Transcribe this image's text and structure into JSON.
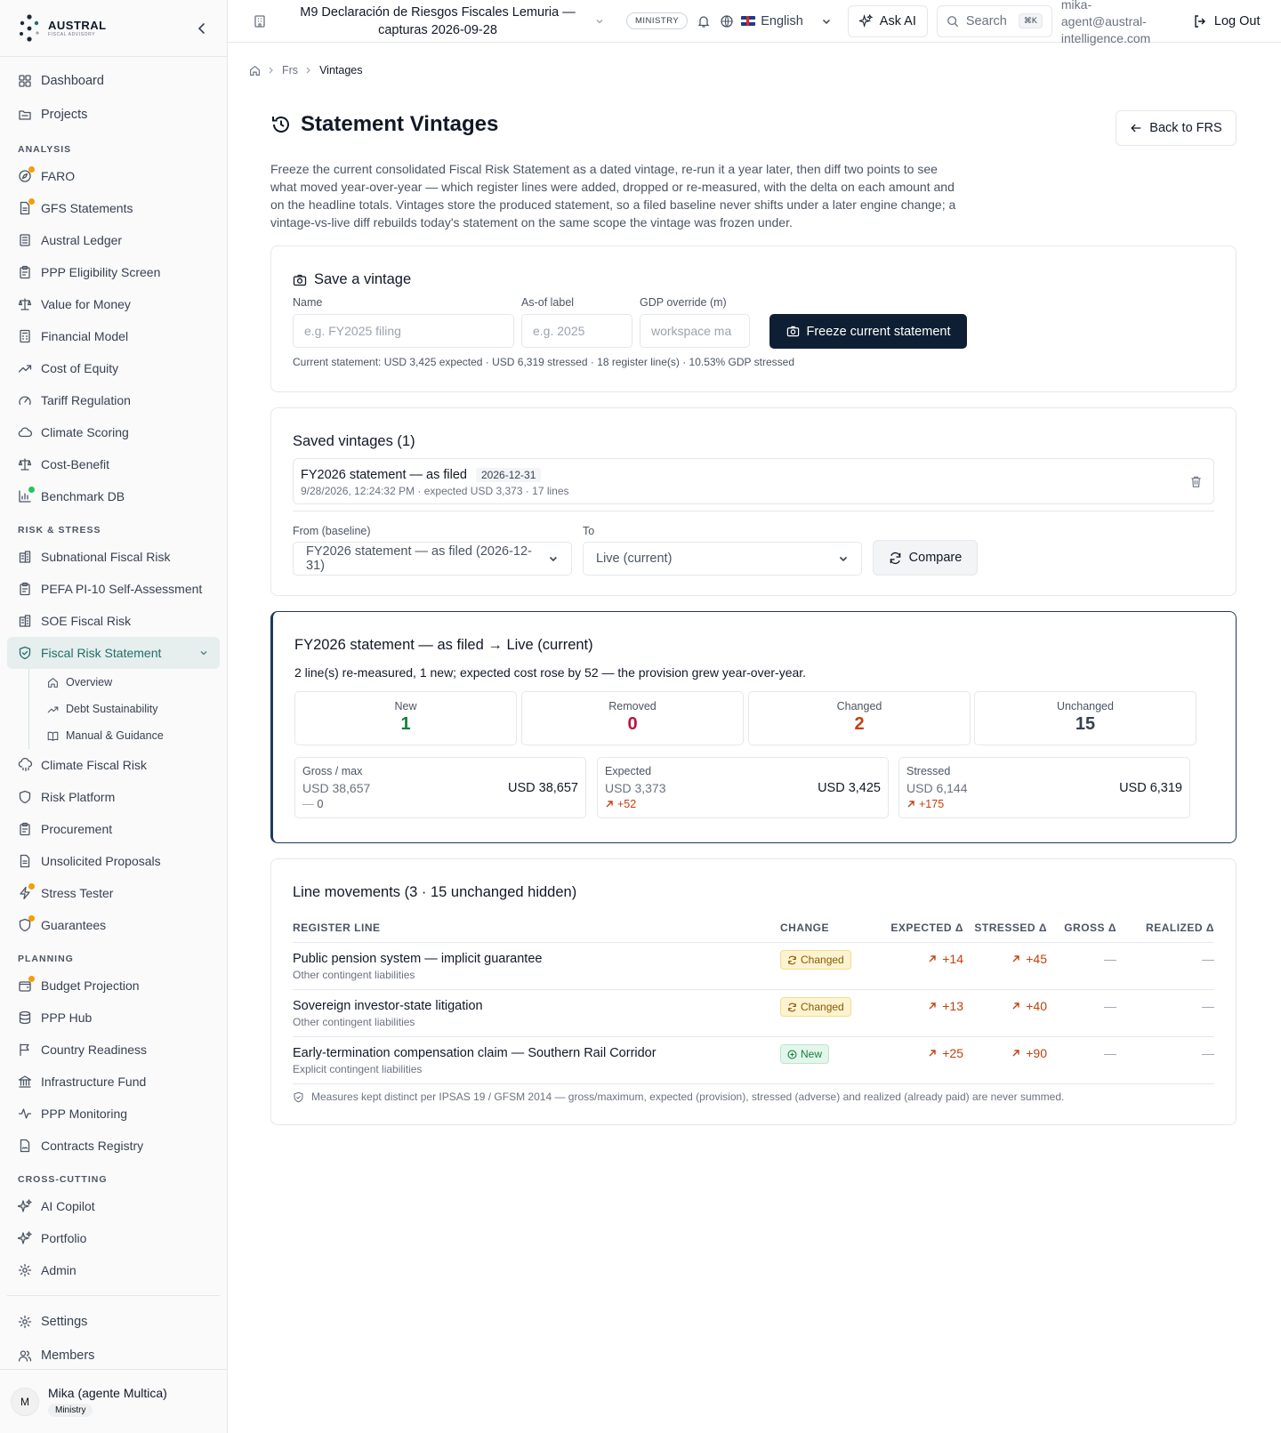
{
  "brand": {
    "name": "AUSTRAL",
    "sub": "FISCAL ADVISORY"
  },
  "topbar": {
    "workspace_title": "M9 Declaración de Riesgos Fiscales Lemuria — capturas 2026-09-28",
    "ministry_badge": "MINISTRY",
    "language": "English",
    "ask_ai": "Ask AI",
    "search": "Search",
    "search_kbd": "⌘K",
    "email": "mika-agent@austral-intelligence.com",
    "logout": "Log Out"
  },
  "sidebar": {
    "top": [
      {
        "label": "Dashboard",
        "icon": "dashboard-icon"
      },
      {
        "label": "Projects",
        "icon": "folder-icon"
      }
    ],
    "sections": [
      {
        "title": "ANALYSIS",
        "items": [
          {
            "label": "FARO",
            "icon": "compass-icon",
            "dot": "#f59e0b"
          },
          {
            "label": "GFS Statements",
            "icon": "file-icon",
            "dot": "#f59e0b"
          },
          {
            "label": "Austral Ledger",
            "icon": "ledger-icon"
          },
          {
            "label": "PPP Eligibility Screen",
            "icon": "clipboard-icon"
          },
          {
            "label": "Value for Money",
            "icon": "scale-icon"
          },
          {
            "label": "Financial Model",
            "icon": "calculator-icon"
          },
          {
            "label": "Cost of Equity",
            "icon": "trend-icon"
          },
          {
            "label": "Tariff Regulation",
            "icon": "gauge-icon"
          },
          {
            "label": "Climate Scoring",
            "icon": "cloud-icon"
          },
          {
            "label": "Cost-Benefit",
            "icon": "scale-icon"
          },
          {
            "label": "Benchmark DB",
            "icon": "chart-icon",
            "dot": "#22c55e"
          }
        ]
      },
      {
        "title": "RISK & STRESS",
        "items": [
          {
            "label": "Subnational Fiscal Risk",
            "icon": "building-icon"
          },
          {
            "label": "PEFA PI-10 Self-Assessment",
            "icon": "clipboard-icon"
          },
          {
            "label": "SOE Fiscal Risk",
            "icon": "building-icon"
          },
          {
            "label": "Fiscal Risk Statement",
            "icon": "shield-check-icon",
            "active": true
          },
          {
            "label": "Climate Fiscal Risk",
            "icon": "cloud-rain-icon"
          },
          {
            "label": "Risk Platform",
            "icon": "shield-icon"
          },
          {
            "label": "Procurement",
            "icon": "clipboard-icon"
          },
          {
            "label": "Unsolicited Proposals",
            "icon": "file-icon"
          },
          {
            "label": "Stress Tester",
            "icon": "zap-icon",
            "dot": "#f59e0b"
          },
          {
            "label": "Guarantees",
            "icon": "shield-icon",
            "dot": "#f59e0b"
          }
        ]
      },
      {
        "title": "PLANNING",
        "items": [
          {
            "label": "Budget Projection",
            "icon": "wallet-icon",
            "dot": "#f59e0b"
          },
          {
            "label": "PPP Hub",
            "icon": "database-icon"
          },
          {
            "label": "Country Readiness",
            "icon": "flag-icon"
          },
          {
            "label": "Infrastructure Fund",
            "icon": "bank-icon"
          },
          {
            "label": "PPP Monitoring",
            "icon": "activity-icon"
          },
          {
            "label": "Contracts Registry",
            "icon": "contract-icon"
          }
        ]
      },
      {
        "title": "CROSS-CUTTING",
        "items": [
          {
            "label": "AI Copilot",
            "icon": "sparkles-icon"
          },
          {
            "label": "Portfolio",
            "icon": "sparkles-icon"
          },
          {
            "label": "Admin",
            "icon": "gear-icon"
          }
        ]
      }
    ],
    "sub_items": [
      {
        "label": "Overview",
        "icon": "home-icon"
      },
      {
        "label": "Debt Sustainability",
        "icon": "trend-icon"
      },
      {
        "label": "Manual & Guidance",
        "icon": "book-icon"
      }
    ],
    "bottom": [
      {
        "label": "Settings",
        "icon": "gear-icon"
      },
      {
        "label": "Members",
        "icon": "users-icon"
      }
    ],
    "user": {
      "initial": "M",
      "name": "Mika (agente Multica)",
      "role": "Ministry"
    }
  },
  "breadcrumb": {
    "items": [
      "Frs",
      "Vintages"
    ]
  },
  "page": {
    "title": "Statement Vintages",
    "back": "Back to FRS",
    "description": "Freeze the current consolidated Fiscal Risk Statement as a dated vintage, re-run it a year later, then diff two points to see what moved year-over-year — which register lines were added, dropped or re-measured, with the delta on each amount and on the headline totals. Vintages store the produced statement, so a filed baseline never shifts under a later engine change; a vintage-vs-live diff rebuilds today's statement on the same scope the vintage was frozen under."
  },
  "save": {
    "title": "Save a vintage",
    "name_label": "Name",
    "name_placeholder": "e.g. FY2025 filing",
    "asof_label": "As-of label",
    "asof_placeholder": "e.g. 2025",
    "gdp_label": "GDP override (m)",
    "gdp_placeholder": "workspace ma",
    "freeze": "Freeze current statement",
    "current": "Current statement: USD 3,425 expected · USD 6,319 stressed · 18 register line(s) · 10.53% GDP stressed"
  },
  "saved": {
    "title": "Saved vintages (1)",
    "vintage_name": "FY2026 statement — as filed",
    "vintage_date": "2026-12-31",
    "vintage_meta": "9/28/2026, 12:24:32 PM · expected USD 3,373 · 17 lines",
    "from_label": "From (baseline)",
    "from_value": "FY2026 statement — as filed (2026-12-31)",
    "to_label": "To",
    "to_value": "Live (current)",
    "compare": "Compare"
  },
  "diff": {
    "title": "FY2026 statement — as filed → Live (current)",
    "summary": "2 line(s) re-measured, 1 new; expected cost rose by 52 — the provision grew year-over-year.",
    "stats": [
      {
        "label": "New",
        "value": "1",
        "color": "#15803d"
      },
      {
        "label": "Removed",
        "value": "0",
        "color": "#be123c"
      },
      {
        "label": "Changed",
        "value": "2",
        "color": "#c2410c"
      },
      {
        "label": "Unchanged",
        "value": "15",
        "color": "#374151"
      }
    ],
    "totals": [
      {
        "label": "Gross / max",
        "old": "USD 38,657",
        "new": "USD 38,657",
        "delta": "0",
        "dir": "flat"
      },
      {
        "label": "Expected",
        "old": "USD 3,373",
        "new": "USD 3,425",
        "delta": "+52",
        "dir": "up"
      },
      {
        "label": "Stressed",
        "old": "USD 6,144",
        "new": "USD 6,319",
        "delta": "+175",
        "dir": "up"
      }
    ]
  },
  "lines": {
    "title": "Line movements (3 · 15 unchanged hidden)",
    "headers": [
      "REGISTER LINE",
      "CHANGE",
      "EXPECTED Δ",
      "STRESSED Δ",
      "GROSS Δ",
      "REALIZED Δ"
    ],
    "rows": [
      {
        "name": "Public pension system — implicit guarantee",
        "category": "Other contingent liabilities",
        "change": "Changed",
        "expected": "+14",
        "stressed": "+45",
        "gross": "—",
        "realized": "—"
      },
      {
        "name": "Sovereign investor-state litigation",
        "category": "Other contingent liabilities",
        "change": "Changed",
        "expected": "+13",
        "stressed": "+40",
        "gross": "—",
        "realized": "—"
      },
      {
        "name": "Early-termination compensation claim — Southern Rail Corridor",
        "category": "Explicit contingent liabilities",
        "change": "New",
        "expected": "+25",
        "stressed": "+90",
        "gross": "—",
        "realized": "—"
      }
    ],
    "footnote": "Measures kept distinct per IPSAS 19 / GFSM 2014 — gross/maximum, expected (provision), stressed (adverse) and realized (already paid) are never summed."
  }
}
